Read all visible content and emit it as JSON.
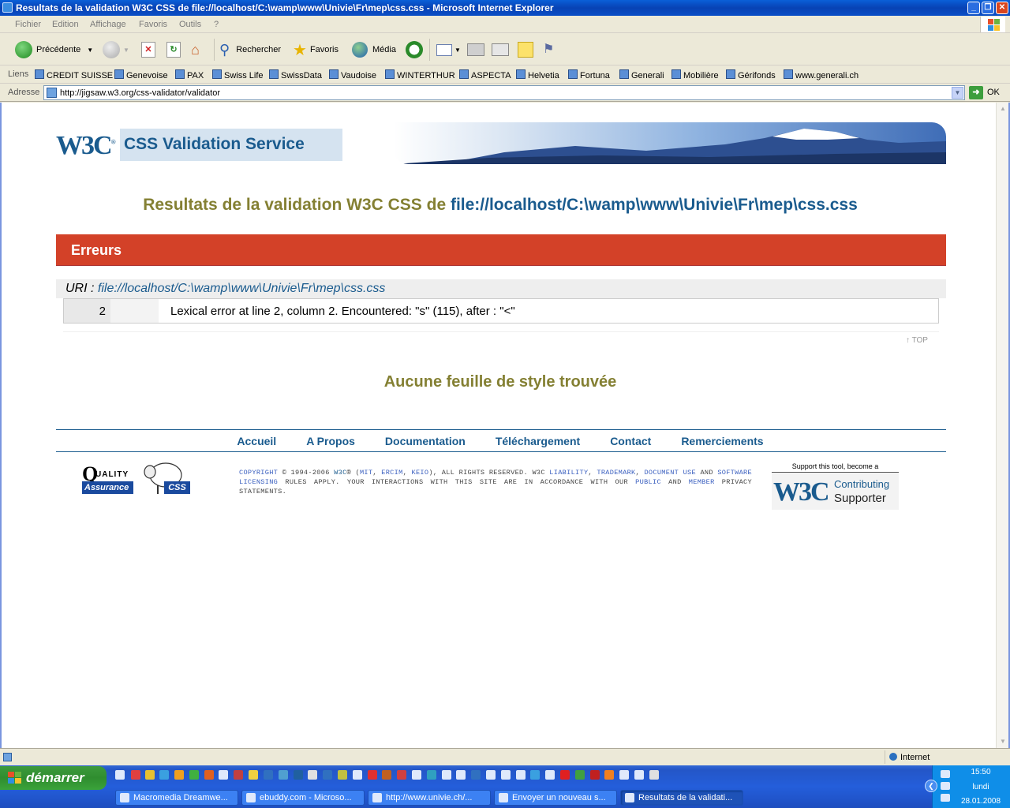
{
  "window": {
    "title": "Resultats de la validation W3C CSS de file://localhost/C:\\wamp\\www\\Univie\\Fr\\mep\\css.css - Microsoft Internet Explorer"
  },
  "menu": [
    "Fichier",
    "Edition",
    "Affichage",
    "Favoris",
    "Outils",
    "?"
  ],
  "toolbar": {
    "back": "Précédente",
    "search": "Rechercher",
    "favorites": "Favoris",
    "media": "Média"
  },
  "links": {
    "label": "Liens",
    "items": [
      "CREDIT SUISSE",
      "Genevoise",
      "PAX",
      "Swiss Life",
      "SwissData",
      "Vaudoise",
      "WINTERTHUR",
      "ASPECTA",
      "Helvetia",
      "Fortuna",
      "Generali",
      "Mobilière",
      "Gérifonds",
      "www.generali.ch"
    ]
  },
  "address": {
    "label": "Adresse",
    "url": "http://jigsaw.w3.org/css-validator/validator",
    "go": "OK"
  },
  "page": {
    "logo": "W3C",
    "service_title": "CSS Validation Service",
    "results_prefix": "Resultats de la validation W3C CSS de ",
    "results_path": "file://localhost/C:\\wamp\\www\\Univie\\Fr\\mep\\css.css",
    "errors_heading": "Erreurs",
    "uri_label": "URI : ",
    "uri_value": "file://localhost/C:\\wamp\\www\\Univie\\Fr\\mep\\css.css",
    "errors": [
      {
        "line": "2",
        "message": "Lexical error at line 2, column 2. Encountered: \"s\" (115), after : \"<\""
      }
    ],
    "top_link": "↑ TOP",
    "no_stylesheet": "Aucune feuille de style trouvée",
    "footer_nav": [
      "Accueil",
      "A Propos",
      "Documentation",
      "Téléchargement",
      "Contact",
      "Remerciements"
    ],
    "qa": {
      "q": "Q",
      "quality": "UALITY",
      "assurance": "Assurance",
      "css": "CSS"
    },
    "copyright": {
      "copyright": "COPYRIGHT",
      "years": " © 1994-2006 ",
      "w3c": "W3C",
      "reg": "® (",
      "mit": "MIT",
      "ercim": "ERCIM",
      "keio": "KEIO",
      "rights": "), ALL RIGHTS RESERVED. W3C ",
      "liability": "LIABILITY",
      "trademark": "TRADEMARK",
      "document_use": "DOCUMENT USE",
      "and1": " AND ",
      "software_licensing": "SOFTWARE LICENSING",
      "rules": " RULES APPLY. YOUR INTERACTIONS WITH THIS SITE ARE IN ACCORDANCE WITH OUR ",
      "public": "PUBLIC",
      "and2": " AND ",
      "member": "MEMBER",
      "privacy": " PRIVACY STATEMENTS."
    },
    "supporter": {
      "text": "Support this tool, become a",
      "logo": "W3C",
      "line1": "Contributing",
      "line2": "Supporter"
    }
  },
  "status": {
    "zone": "Internet"
  },
  "taskbar": {
    "start": "démarrer",
    "tasks": [
      "Macromedia Dreamwe...",
      "ebuddy.com - Microso...",
      "http://www.univie.ch/...",
      "Envoyer un nouveau s...",
      "Resultats de la validati..."
    ],
    "clock_time": "15:50",
    "clock_day": "lundi",
    "clock_date": "28.01.2008"
  },
  "colors": {
    "accent_blue": "#1a5b8e",
    "olive_heading": "#848033",
    "error_red": "#d34128"
  }
}
